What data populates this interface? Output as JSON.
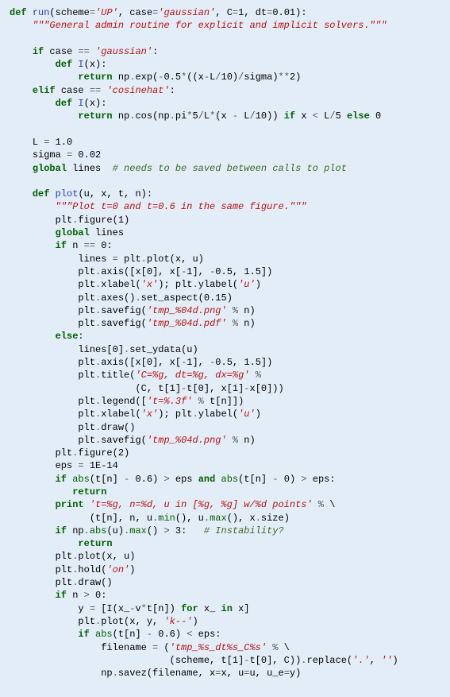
{
  "code": {
    "l01_def": "def",
    "l01_run": "run",
    "l01_open": "(",
    "l01_scheme": "scheme",
    "l01_eq1": "=",
    "l01_up": "'UP'",
    "l01_c1": ", ",
    "l01_case": "case",
    "l01_eq2": "=",
    "l01_gauss": "'gaussian'",
    "l01_c2": ", ",
    "l01_C": "C",
    "l01_eq3": "=",
    "l01_1": "1",
    "l01_c3": ", ",
    "l01_dt": "dt",
    "l01_eq4": "=",
    "l01_001": "0.01",
    "l01_close": "):",
    "l02_doc": "\"\"\"General admin routine for explicit and implicit solvers.\"\"\"",
    "l03_if": "if",
    "l03_case": " case ",
    "l03_eq": "==",
    "l03_sp": " ",
    "l03_g": "'gaussian'",
    "l03_cl": ":",
    "l04_def": "def",
    "l04_I": "I",
    "l04_px": "(x):",
    "l05_ret": "return",
    "l05_np": " np",
    "l05_dot": ".",
    "l05_exp": "exp",
    "l05_rest1": "(",
    "l05_op1": "-",
    "l05_05": "0.5",
    "l05_op2": "*",
    "l05_p2": "((x",
    "l05_op3": "-",
    "l05_L": "L",
    "l05_op4": "/",
    "l05_10": "10",
    "l05_p3": ")",
    "l05_op5": "/",
    "l05_sigma": "sigma)",
    "l05_op6": "**",
    "l05_2": "2",
    "l05_p4": ")",
    "l06_elif": "elif",
    "l06_case": " case ",
    "l06_eq": "==",
    "l06_sp": " ",
    "l06_cos": "'cosinehat'",
    "l06_cl": ":",
    "l07_def": "def",
    "l07_I": "I",
    "l07_px": "(x):",
    "l08_ret": "return",
    "l08_np": " np",
    "l08_dot": ".",
    "l08_cos": "cos",
    "l08_p1": "(np",
    "l08_dot2": ".",
    "l08_pi": "pi",
    "l08_op1": "*",
    "l08_5": "5",
    "l08_op2": "/",
    "l08_L": "L",
    "l08_op3": "*",
    "l08_p2": "(x ",
    "l08_op4": "-",
    "l08_sp2": " L",
    "l08_op5": "/",
    "l08_10": "10",
    "l08_p3": ")) ",
    "l08_if": "if",
    "l08_x": " x ",
    "l08_op6": "<",
    "l08_sp3": " L",
    "l08_op7": "/",
    "l08_5b": "5",
    "l08_sp4": " ",
    "l08_else": "else",
    "l08_0": " 0",
    "l09_L": "L ",
    "l09_eq": "=",
    "l09_1": " 1.0",
    "l10_sigma": "sigma ",
    "l10_eq": "=",
    "l10_002": " 0.02",
    "l11_global": "global",
    "l11_lines": " lines  ",
    "l11_cm": "# needs to be saved between calls to plot",
    "l12_def": "def",
    "l12_plot": "plot",
    "l12_args": "(u, x, t, n):",
    "l13_doc": "\"\"\"Plot t=0 and t=0.6 in the same figure.\"\"\"",
    "l14_plt": "plt",
    "l14_dot": ".",
    "l14_fig": "figure",
    "l14_p": "(",
    "l14_1": "1",
    "l14_cp": ")",
    "l15_global": "global",
    "l15_lines": " lines",
    "l16_if": "if",
    "l16_n": " n ",
    "l16_eq": "==",
    "l16_0": " 0",
    "l16_cl": ":",
    "l17_lines": "lines ",
    "l17_eq": "=",
    "l17_plt": " plt",
    "l17_dot": ".",
    "l17_plot": "plot",
    "l17_args": "(x, u)",
    "l18_plt": "plt",
    "l18_dot": ".",
    "l18_axis": "axis",
    "l18_p1": "([x[",
    "l18_0": "0",
    "l18_p2": "], x[",
    "l18_op": "-",
    "l18_1": "1",
    "l18_p3": "], ",
    "l18_op2": "-",
    "l18_05": "0.5",
    "l18_c": ", ",
    "l18_15": "1.5",
    "l18_p4": "])",
    "l19_plt": "plt",
    "l19_dot": ".",
    "l19_xl": "xlabel",
    "l19_p": "(",
    "l19_s": "'x'",
    "l19_cp": "); plt",
    "l19_dot2": ".",
    "l19_yl": "ylabel",
    "l19_p2": "(",
    "l19_s2": "'u'",
    "l19_cp2": ")",
    "l20_plt": "plt",
    "l20_dot": ".",
    "l20_axes": "axes",
    "l20_p": "()",
    "l20_dot2": ".",
    "l20_set": "set_aspect",
    "l20_p2": "(",
    "l20_015": "0.15",
    "l20_cp": ")",
    "l21_plt": "plt",
    "l21_dot": ".",
    "l21_sf": "savefig",
    "l21_p": "(",
    "l21_s": "'tmp_%04d.png'",
    "l21_sp": " ",
    "l21_op": "%",
    "l21_n": " n)",
    "l22_plt": "plt",
    "l22_dot": ".",
    "l22_sf": "savefig",
    "l22_p": "(",
    "l22_s": "'tmp_%04d.pdf'",
    "l22_sp": " ",
    "l22_op": "%",
    "l22_n": " n)",
    "l23_else": "else",
    "l23_cl": ":",
    "l24_lines": "lines[",
    "l24_0": "0",
    "l24_p": "]",
    "l24_dot": ".",
    "l24_sy": "set_ydata",
    "l24_args": "(u)",
    "l25_plt": "plt",
    "l25_dot": ".",
    "l25_axis": "axis",
    "l25_p1": "([x[",
    "l25_0": "0",
    "l25_p2": "], x[",
    "l25_op": "-",
    "l25_1": "1",
    "l25_p3": "], ",
    "l25_op2": "-",
    "l25_05": "0.5",
    "l25_c": ", ",
    "l25_15": "1.5",
    "l25_p4": "])",
    "l26_plt": "plt",
    "l26_dot": ".",
    "l26_title": "title",
    "l26_p": "(",
    "l26_s": "'C=%g, dt=%g, dx=%g'",
    "l26_sp": " ",
    "l26_op": "%",
    "l27_args": "(C, t[",
    "l27_1": "1",
    "l27_p": "]",
    "l27_op": "-",
    "l27_t": "t[",
    "l27_0": "0",
    "l27_p2": "], x[",
    "l27_1b": "1",
    "l27_p3": "]",
    "l27_op2": "-",
    "l27_x": "x[",
    "l27_0b": "0",
    "l27_p4": "]))",
    "l28_plt": "plt",
    "l28_dot": ".",
    "l28_leg": "legend",
    "l28_p": "([",
    "l28_s": "'t=%.3f'",
    "l28_sp": " ",
    "l28_op": "%",
    "l28_t": " t[n]])",
    "l29_plt": "plt",
    "l29_dot": ".",
    "l29_xl": "xlabel",
    "l29_p": "(",
    "l29_s": "'x'",
    "l29_cp": "); plt",
    "l29_dot2": ".",
    "l29_yl": "ylabel",
    "l29_p2": "(",
    "l29_s2": "'u'",
    "l29_cp2": ")",
    "l30_plt": "plt",
    "l30_dot": ".",
    "l30_draw": "draw",
    "l30_p": "()",
    "l31_plt": "plt",
    "l31_dot": ".",
    "l31_sf": "savefig",
    "l31_p": "(",
    "l31_s": "'tmp_%04d.png'",
    "l31_sp": " ",
    "l31_op": "%",
    "l31_n": " n)",
    "l32_plt": "plt",
    "l32_dot": ".",
    "l32_fig": "figure",
    "l32_p": "(",
    "l32_2": "2",
    "l32_cp": ")",
    "l33_eps": "eps ",
    "l33_eq": "=",
    "l33_v": " 1E-14",
    "l34_if": "if",
    "l34_sp": " ",
    "l34_abs": "abs",
    "l34_p": "(t[n] ",
    "l34_op": "-",
    "l34_06": " 0.6",
    "l34_p2": ") ",
    "l34_op2": ">",
    "l34_eps": " eps ",
    "l34_and": "and",
    "l34_sp2": " ",
    "l34_abs2": "abs",
    "l34_p3": "(t[n] ",
    "l34_op3": "-",
    "l34_0": " 0",
    "l34_p4": ") ",
    "l34_op4": ">",
    "l34_eps2": " eps:",
    "l35_ret": "return",
    "l36_print": "print",
    "l36_sp": " ",
    "l36_s": "'t=%g, n=%d, u in [%g, %g] w/%d points'",
    "l36_sp2": " ",
    "l36_op": "%",
    "l36_bs": " \\",
    "l37_p": "(t[n], n, u",
    "l37_dot": ".",
    "l37_min": "min",
    "l37_p2": "(), u",
    "l37_dot2": ".",
    "l37_max": "max",
    "l37_p3": "(), x",
    "l37_dot3": ".",
    "l37_size": "size)",
    "l38_if": "if",
    "l38_np": " np",
    "l38_dot": ".",
    "l38_abs": "abs",
    "l38_p": "(u)",
    "l38_dot2": ".",
    "l38_max": "max",
    "l38_p2": "() ",
    "l38_op": ">",
    "l38_3": " 3",
    "l38_cl": ":   ",
    "l38_cm": "# Instability?",
    "l39_ret": "return",
    "l40_plt": "plt",
    "l40_dot": ".",
    "l40_plot": "plot",
    "l40_args": "(x, u)",
    "l41_plt": "plt",
    "l41_dot": ".",
    "l41_hold": "hold",
    "l41_p": "(",
    "l41_s": "'on'",
    "l41_cp": ")",
    "l42_plt": "plt",
    "l42_dot": ".",
    "l42_draw": "draw",
    "l42_p": "()",
    "l43_if": "if",
    "l43_n": " n ",
    "l43_op": ">",
    "l43_0": " 0",
    "l43_cl": ":",
    "l44_y": "y ",
    "l44_eq": "=",
    "l44_sp": " [I(x_",
    "l44_op": "-",
    "l44_v": "v",
    "l44_op2": "*",
    "l44_t": "t[n]) ",
    "l44_for": "for",
    "l44_x": " x_ ",
    "l44_in": "in",
    "l44_xv": " x]",
    "l45_plt": "plt",
    "l45_dot": ".",
    "l45_plot": "plot",
    "l45_p": "(x, y, ",
    "l45_s": "'k--'",
    "l45_cp": ")",
    "l46_if": "if",
    "l46_sp": " ",
    "l46_abs": "abs",
    "l46_p": "(t[n] ",
    "l46_op": "-",
    "l46_06": " 0.6",
    "l46_p2": ") ",
    "l46_op2": "<",
    "l46_eps": " eps:",
    "l47_fn": "filename ",
    "l47_eq": "=",
    "l47_p": " (",
    "l47_s": "'tmp_%s_dt%s_C%s'",
    "l47_sp": " ",
    "l47_op": "%",
    "l47_bs": " \\",
    "l48_p": "(scheme, t[",
    "l48_1": "1",
    "l48_p2": "]",
    "l48_op": "-",
    "l48_t": "t[",
    "l48_0": "0",
    "l48_p3": "], C))",
    "l48_dot": ".",
    "l48_rep": "replace",
    "l48_p4": "(",
    "l48_s1": "'.'",
    "l48_c": ", ",
    "l48_s2": "''",
    "l48_p5": ")",
    "l49_np": "np",
    "l49_dot": ".",
    "l49_savez": "savez",
    "l49_p": "(filename, x",
    "l49_eq1": "=",
    "l49_x": "x, u",
    "l49_eq2": "=",
    "l49_u": "u, u_e",
    "l49_eq3": "=",
    "l49_y": "y)"
  }
}
